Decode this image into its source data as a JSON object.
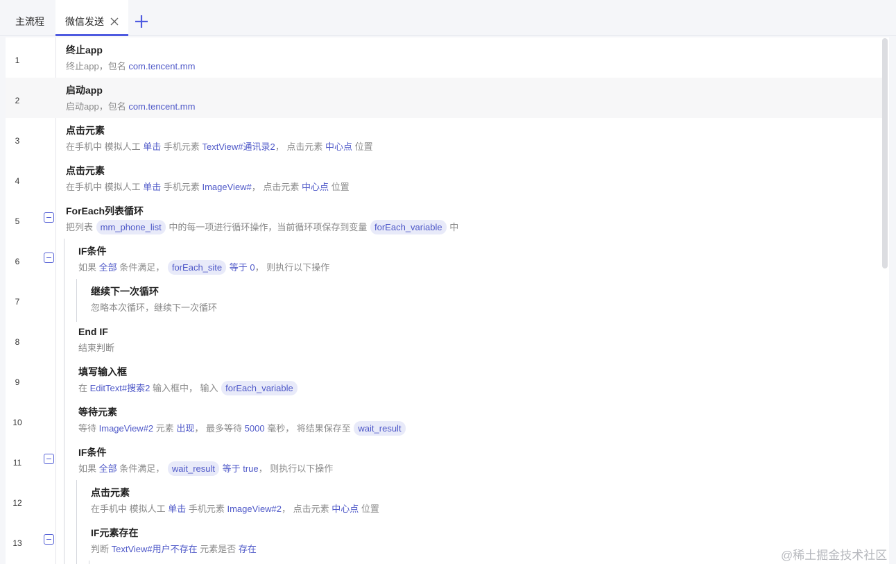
{
  "tabs": {
    "main_label": "主流程",
    "active_label": "微信发送"
  },
  "rows": [
    {
      "no": "1",
      "title": "终止app",
      "desc": [
        {
          "t": "终止app，包名 "
        },
        {
          "t": "com.tencent.mm",
          "k": "kw"
        }
      ]
    },
    {
      "no": "2",
      "title": "启动app",
      "desc": [
        {
          "t": "启动app，包名 "
        },
        {
          "t": "com.tencent.mm",
          "k": "kw"
        }
      ]
    },
    {
      "no": "3",
      "title": "点击元素",
      "desc": [
        {
          "t": "在手机中 模拟人工 "
        },
        {
          "t": "单击",
          "k": "kw"
        },
        {
          "t": " 手机元素 "
        },
        {
          "t": "TextView#通讯录2",
          "k": "kw"
        },
        {
          "t": "， 点击元素 "
        },
        {
          "t": "中心点",
          "k": "kw"
        },
        {
          "t": " 位置"
        }
      ]
    },
    {
      "no": "4",
      "title": "点击元素",
      "desc": [
        {
          "t": "在手机中 模拟人工 "
        },
        {
          "t": "单击",
          "k": "kw"
        },
        {
          "t": " 手机元素 "
        },
        {
          "t": "ImageView#",
          "k": "kw"
        },
        {
          "t": "， 点击元素 "
        },
        {
          "t": "中心点",
          "k": "kw"
        },
        {
          "t": " 位置"
        }
      ]
    },
    {
      "no": "5",
      "title": "ForEach列表循环",
      "desc": [
        {
          "t": "把列表 "
        },
        {
          "t": "mm_phone_list",
          "k": "chip"
        },
        {
          "t": " 中的每一项进行循环操作，当前循环项保存到变量 "
        },
        {
          "t": "forEach_variable",
          "k": "chip"
        },
        {
          "t": " 中"
        }
      ]
    },
    {
      "no": "6",
      "title": "IF条件",
      "desc": [
        {
          "t": "如果 "
        },
        {
          "t": "全部",
          "k": "kw"
        },
        {
          "t": " 条件满足，  "
        },
        {
          "t": "forEach_site",
          "k": "chip"
        },
        {
          "t": " 等于 0",
          "k": "kw"
        },
        {
          "t": "，  则执行以下操作"
        }
      ]
    },
    {
      "no": "7",
      "title": "继续下一次循环",
      "desc": [
        {
          "t": "忽略本次循环，继续下一次循环"
        }
      ]
    },
    {
      "no": "8",
      "title": "End IF",
      "desc": [
        {
          "t": "结束判断"
        }
      ]
    },
    {
      "no": "9",
      "title": "填写输入框",
      "desc": [
        {
          "t": "在 "
        },
        {
          "t": "EditText#搜索2",
          "k": "kw"
        },
        {
          "t": " 输入框中，  输入 "
        },
        {
          "t": "forEach_variable",
          "k": "chip"
        }
      ]
    },
    {
      "no": "10",
      "title": "等待元素",
      "desc": [
        {
          "t": "等待 "
        },
        {
          "t": "ImageView#2",
          "k": "kw"
        },
        {
          "t": " 元素 "
        },
        {
          "t": "出现",
          "k": "kw"
        },
        {
          "t": "， 最多等待 "
        },
        {
          "t": "5000",
          "k": "kw"
        },
        {
          "t": " 毫秒， 将结果保存至 "
        },
        {
          "t": "wait_result",
          "k": "chip"
        }
      ]
    },
    {
      "no": "11",
      "title": "IF条件",
      "desc": [
        {
          "t": "如果 "
        },
        {
          "t": "全部",
          "k": "kw"
        },
        {
          "t": " 条件满足，  "
        },
        {
          "t": "wait_result",
          "k": "chip"
        },
        {
          "t": " 等于 true",
          "k": "kw"
        },
        {
          "t": "，  则执行以下操作"
        }
      ]
    },
    {
      "no": "12",
      "title": "点击元素",
      "desc": [
        {
          "t": "在手机中 模拟人工 "
        },
        {
          "t": "单击",
          "k": "kw"
        },
        {
          "t": " 手机元素 "
        },
        {
          "t": "ImageView#2",
          "k": "kw"
        },
        {
          "t": "， 点击元素 "
        },
        {
          "t": "中心点",
          "k": "kw"
        },
        {
          "t": " 位置"
        }
      ]
    },
    {
      "no": "13",
      "title": "IF元素存在",
      "desc": [
        {
          "t": "判断 "
        },
        {
          "t": "TextView#用户不存在",
          "k": "kw"
        },
        {
          "t": " 元素是否 "
        },
        {
          "t": "存在",
          "k": "kw"
        }
      ]
    }
  ],
  "watermark": "@稀土掘金技术社区",
  "colors": {
    "accent": "#4e5ae0",
    "chip_bg": "#e8eaf9",
    "keyword": "#4e58c8"
  },
  "icons": {
    "tab_close": "close-icon",
    "tab_add": "plus-icon",
    "fold": "collapse-icon"
  }
}
